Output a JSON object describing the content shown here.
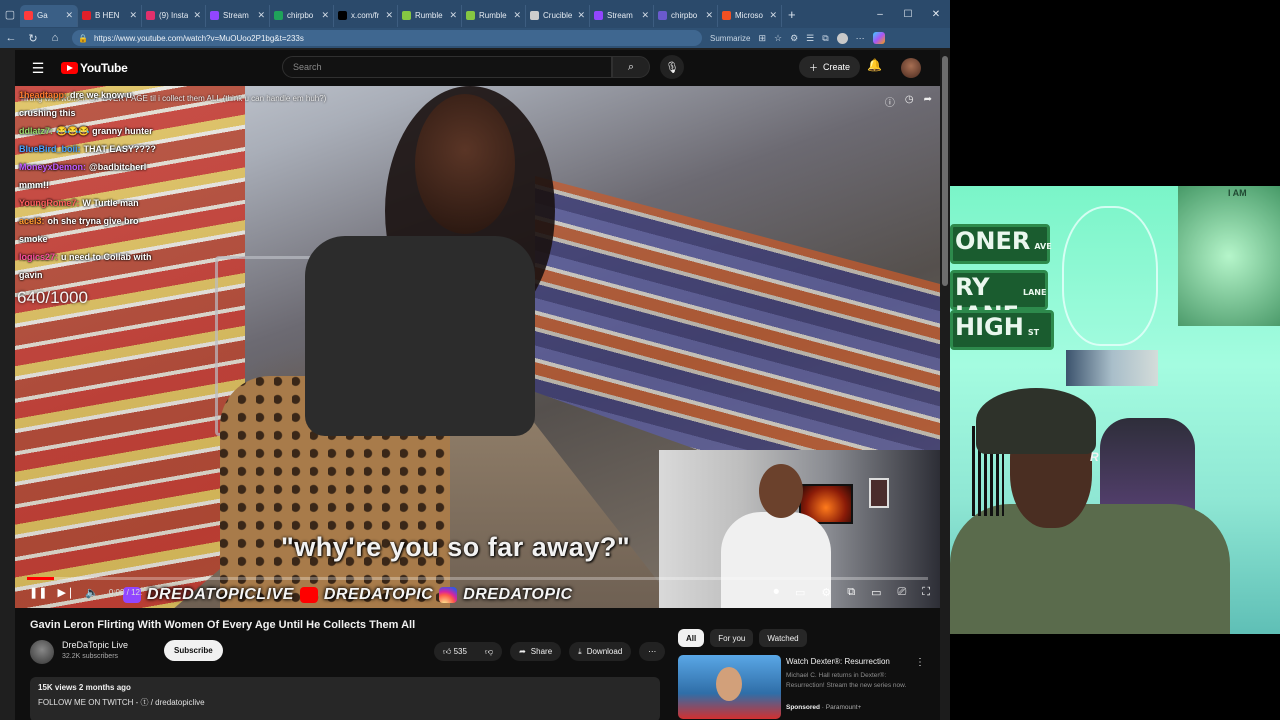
{
  "browser": {
    "tabs": [
      {
        "title": "Ga",
        "fav": "#ff3b3b",
        "active": true
      },
      {
        "title": "B HEN",
        "fav": "#e0202a"
      },
      {
        "title": "(9) Insta",
        "fav": "#e1306c"
      },
      {
        "title": "Stream",
        "fav": "#9146ff"
      },
      {
        "title": "chirpbo",
        "fav": "#1fa35a"
      },
      {
        "title": "x.com/fr",
        "fav": "#000000"
      },
      {
        "title": "Rumble",
        "fav": "#85c742"
      },
      {
        "title": "Rumble",
        "fav": "#85c742"
      },
      {
        "title": "Crucible",
        "fav": "#cccccc"
      },
      {
        "title": "Stream",
        "fav": "#9146ff"
      },
      {
        "title": "chirpbo",
        "fav": "#6a5acd"
      },
      {
        "title": "Microso",
        "fav": "#f25022"
      }
    ],
    "new_tab": "+",
    "window_controls": [
      "–",
      "☐",
      "✕"
    ],
    "url": "https://www.youtube.com/watch?v=MuOUoo2P1bg&t=233s",
    "summarize": "Summarize"
  },
  "youtube": {
    "logo_text": "YouTube",
    "search_placeholder": "Search",
    "create_label": "Create"
  },
  "video": {
    "overlay_title": "flirting with women OF EVERY AGE til i collect them ALL (think u can handle em huh?)",
    "chat": [
      {
        "user": "1headtapp:",
        "text": "dre we know u",
        "color": "#ff7a2e"
      },
      {
        "user": "",
        "text": "crushing this",
        "color": "#ffffff"
      },
      {
        "user": "ddlatz7:",
        "text": "😂😂😂 granny hunter",
        "color": "#9ad96a"
      },
      {
        "user": "BlueBird_boii:",
        "text": "THAT EASY????",
        "color": "#4aa3ff"
      },
      {
        "user": "MoneyxDemon:",
        "text": "@badbitcherl",
        "color": "#c25cff"
      },
      {
        "user": "",
        "text": "mmm!!",
        "color": "#ffffff"
      },
      {
        "user": "YoungRome7:",
        "text": "W Turtle man",
        "color": "#ff5e5e"
      },
      {
        "user": "acel3:",
        "text": "oh she tryna give bro",
        "color": "#ff9a2e"
      },
      {
        "user": "",
        "text": "smoke",
        "color": "#ffffff"
      },
      {
        "user": "logics27:",
        "text": "u need to Collab with",
        "color": "#ff4fa0"
      },
      {
        "user": "",
        "text": "gavin",
        "color": "#ffffff"
      }
    ],
    "counter": "640/1000",
    "caption": "\"why're you so far away?\"",
    "banner": [
      "DREDATOPICLIVE",
      "DREDATOPIC",
      "DREDATOPIC"
    ],
    "time": "0:00 / 12:",
    "progress_fraction": 0.03
  },
  "below": {
    "title": "Gavin Leron Flirting With Women Of Every Age Until He Collects Them All",
    "channel_name": "DreDaTopic Live",
    "subscribers": "32.2K subscribers",
    "subscribe_label": "Subscribe",
    "likes": "535",
    "share_label": "Share",
    "download_label": "Download",
    "views_meta": "15K views  2 months ago",
    "desc_line": "FOLLOW ME ON TWITCH - ⓣ / dredatopiclive"
  },
  "sidebar": {
    "chips": [
      "All",
      "For you",
      "Watched"
    ],
    "ad_title": "Watch Dexter®: Resurrection",
    "ad_desc": "Michael C. Hall returns in Dexter®: Resurrection! Stream the new series now.",
    "ad_sponsored": "Sponsored",
    "ad_advertiser": "· Paramount+"
  },
  "webcam": {
    "sign1": "ONER",
    "sign1_small": "AVE",
    "sign2": "RY JANE",
    "sign2_small": "LANE",
    "sign3": "HIGH",
    "sign3_small": "ST",
    "poster_label": "I AM"
  },
  "icons": {
    "search": "search-icon",
    "mic": "mic-icon",
    "bell": "bell-icon",
    "like": "thumbs-up-icon",
    "dislike": "thumbs-down-icon",
    "share": "share-icon",
    "download": "download-icon"
  }
}
